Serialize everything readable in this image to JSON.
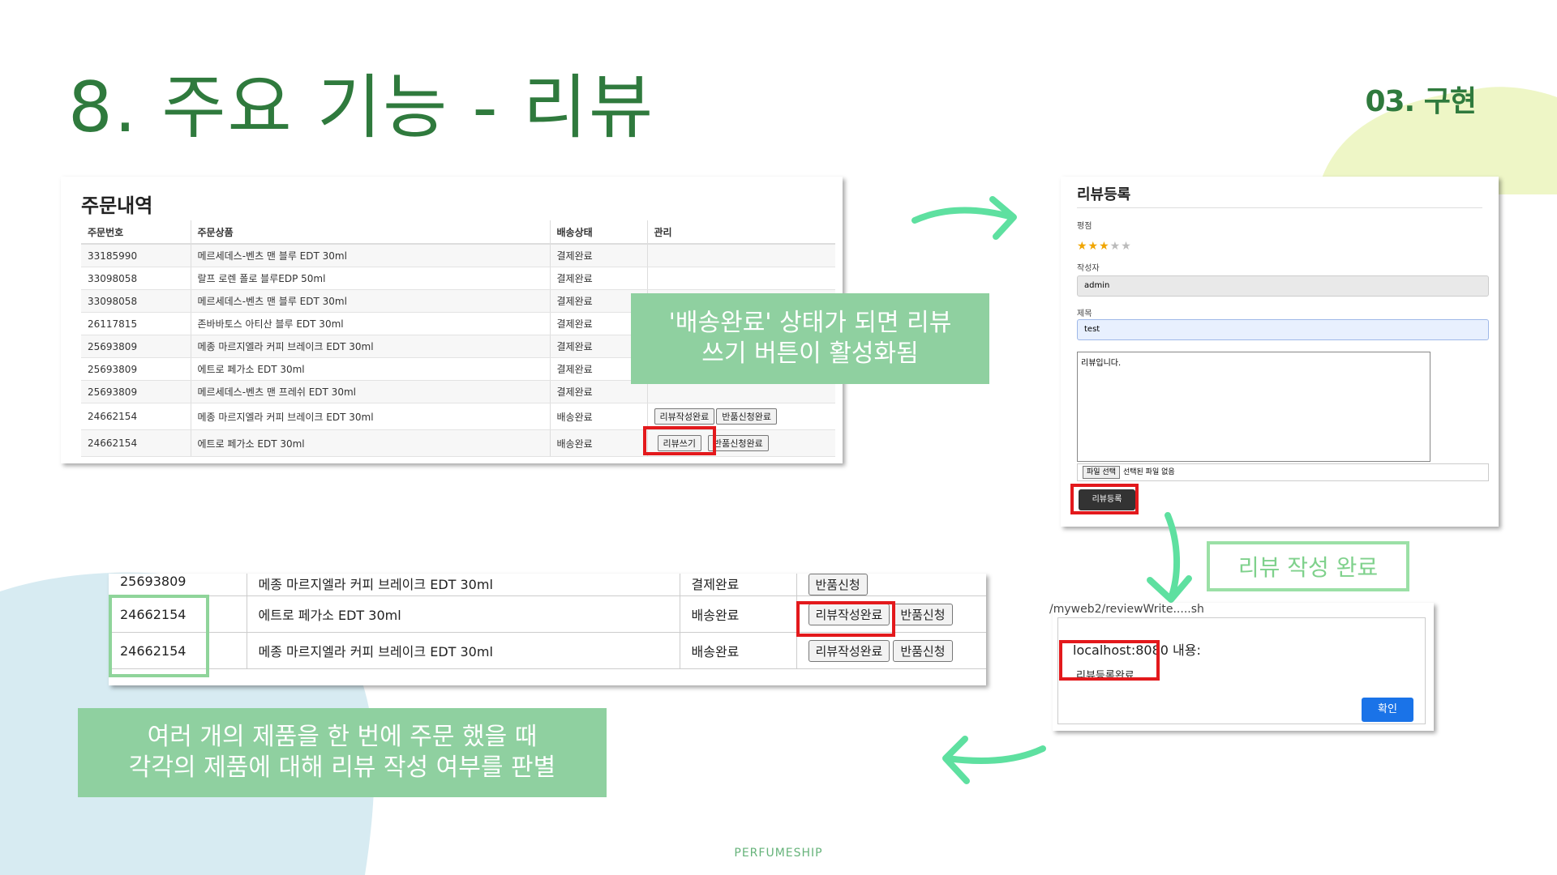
{
  "slide": {
    "title": "8. 주요 기능 - 리뷰",
    "section": "03. 구현",
    "footer": "PERFUMESHIP"
  },
  "order_history": {
    "title": "주문내역",
    "columns": [
      "주문번호",
      "주문상품",
      "배송상태",
      "관리"
    ],
    "rows": [
      {
        "id": "33185990",
        "product": "메르세데스-벤츠 맨 블루 EDT 30ml",
        "status": "결제완료"
      },
      {
        "id": "33098058",
        "product": "랄프 로렌 폴로 블루EDP 50ml",
        "status": "결제완료"
      },
      {
        "id": "33098058",
        "product": "메르세데스-벤츠 맨 블루 EDT 30ml",
        "status": "결제완료"
      },
      {
        "id": "26117815",
        "product": "존바바토스 아티산 블루 EDT 30ml",
        "status": "결제완료"
      },
      {
        "id": "25693809",
        "product": "메종 마르지엘라 커피 브레이크 EDT 30ml",
        "status": "결제완료"
      },
      {
        "id": "25693809",
        "product": "에트로 페가소 EDT 30ml",
        "status": "결제완료"
      },
      {
        "id": "25693809",
        "product": "메르세데스-벤츠 맨 프레쉬 EDT 30ml",
        "status": "결제완료"
      },
      {
        "id": "24662154",
        "product": "메종 마르지엘라 커피 브레이크 EDT 30ml",
        "status": "배송완료",
        "btn1": "리뷰작성완료",
        "btn2": "반품신청완료"
      },
      {
        "id": "24662154",
        "product": "에트로 페가소 EDT 30ml",
        "status": "배송완료",
        "btn1": "리뷰쓰기",
        "btn2": "반품신청완료"
      }
    ]
  },
  "note_top": "'배송완료' 상태가 되면 리뷰\n쓰기 버튼이 활성화됨",
  "review_form": {
    "title": "리뷰등록",
    "rating_label": "평점",
    "rating": 3,
    "rating_max": 5,
    "author_label": "작성자",
    "author_value": "admin",
    "subject_label": "제목",
    "subject_value": "test",
    "content_value": "리뷰입니다.",
    "file_button": "파일 선택",
    "file_status": "선택된 파일 없음",
    "submit": "리뷰등록"
  },
  "note_complete": "리뷰 작성 완료",
  "alert": {
    "url": "/myweb2/reviewWrite.....sh",
    "heading": "localhost:8080 내용:",
    "message": "리뷰등록완료",
    "ok": "확인"
  },
  "zoom_table": {
    "rows": [
      {
        "id": "25693809",
        "product": "메종 마르지엘라 커피 브레이크 EDT 30ml",
        "status": "결제완료",
        "btn1": "반품신청",
        "btn2": ""
      },
      {
        "id": "24662154",
        "product": "에트로 페가소 EDT 30ml",
        "status": "배송완료",
        "btn1": "리뷰작성완료",
        "btn2": "반품신청"
      },
      {
        "id": "24662154",
        "product": "메종 마르지엘라 커피 브레이크 EDT 30ml",
        "status": "배송완료",
        "btn1": "리뷰작성완료",
        "btn2": "반품신청"
      }
    ]
  },
  "note_bottom": "여러 개의 제품을 한 번에 주문 했을 때\n각각의 제품에 대해 리뷰 작성 여부를 판별",
  "colors": {
    "title_green": "#2f7a3d",
    "note_green": "#8fd0a0",
    "highlight_red": "#e3191c",
    "arrow_green": "#5ee0a0"
  }
}
